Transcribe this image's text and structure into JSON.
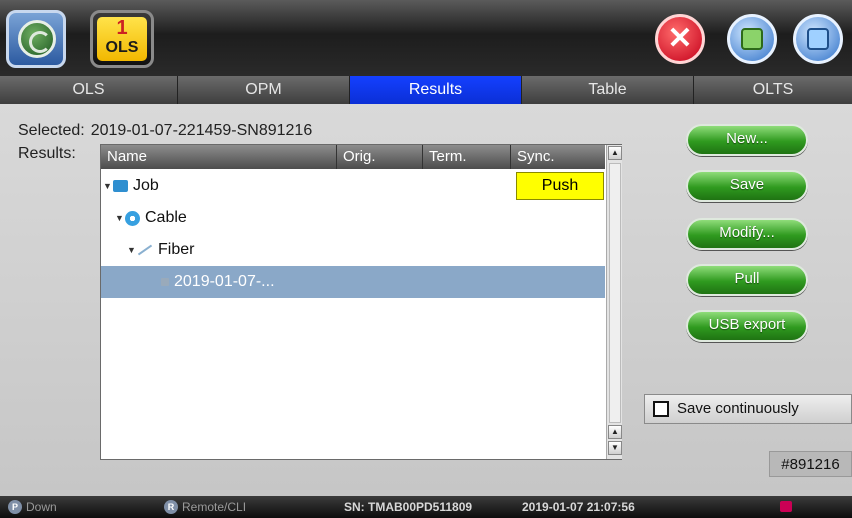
{
  "topbar": {
    "ols_badge_number": "1",
    "ols_badge_label": "OLS",
    "icons": [
      "home-icon",
      "close-icon",
      "share-icon",
      "save-icon"
    ],
    "close_glyph": "✕"
  },
  "tabs": [
    {
      "label": "OLS",
      "active": false
    },
    {
      "label": "OPM",
      "active": false
    },
    {
      "label": "Results",
      "active": true
    },
    {
      "label": "Table",
      "active": false
    },
    {
      "label": "OLTS",
      "active": false
    }
  ],
  "main": {
    "selected_label": "Selected:",
    "selected_value": "2019-01-07-221459-SN891216",
    "results_label": "Results:",
    "tree": {
      "columns": [
        "Name",
        "Orig.",
        "Term.",
        "Sync."
      ],
      "rows": [
        {
          "name": "Job",
          "icon": "job-icon",
          "expanded": true
        },
        {
          "name": "Cable",
          "icon": "cable-icon",
          "expanded": true
        },
        {
          "name": "Fiber",
          "icon": "fiber-icon",
          "expanded": true
        },
        {
          "name": "2019-01-07-...",
          "icon": "file-icon",
          "selected": true
        }
      ],
      "sync_value": "Push"
    },
    "buttons": {
      "new": "New...",
      "save": "Save",
      "modify": "Modify...",
      "pull": "Pull",
      "usb_export": "USB export"
    },
    "save_continuously_label": "Save continuously",
    "save_continuously_checked": false,
    "serial_tag": "#891216"
  },
  "status": {
    "down": "Down",
    "remote": "Remote/CLI",
    "serial": "SN: TMAB00PD511809",
    "datetime": "2019-01-07  21:07:56",
    "down_icon_letter": "P",
    "remote_icon_letter": "R"
  },
  "colors": {
    "active_tab": "#1440ff",
    "push_cell": "#ffff00",
    "selected_row": "#8aa8c8",
    "pill_button": "#2f9a1f",
    "close_button": "#c4001a"
  }
}
